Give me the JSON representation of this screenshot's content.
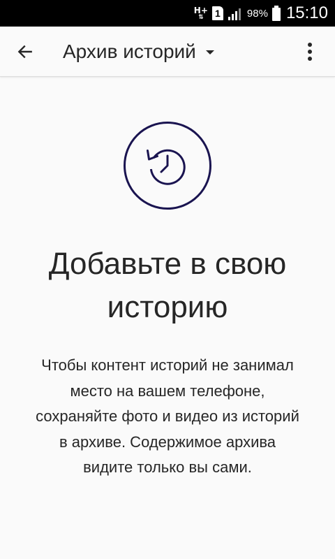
{
  "status_bar": {
    "network": "H+",
    "sim_slot": "1",
    "battery_percent": "98%",
    "time": "15:10",
    "icons": [
      "network-hplus-icon",
      "sim-icon",
      "signal-icon",
      "battery-icon"
    ]
  },
  "app_bar": {
    "title": "Архив историй",
    "back_icon": "arrow-left-icon",
    "dropdown_icon": "caret-down-icon",
    "menu_icon": "more-vertical-icon"
  },
  "empty_state": {
    "icon": "history-clock-icon",
    "accent_color": "#1a1450",
    "headline": "Добавьте в свою историю",
    "body": "Чтобы контент историй не занимал место на вашем телефоне, сохраняйте фото и видео из историй в архиве. Содержимое архива видите только вы сами."
  }
}
